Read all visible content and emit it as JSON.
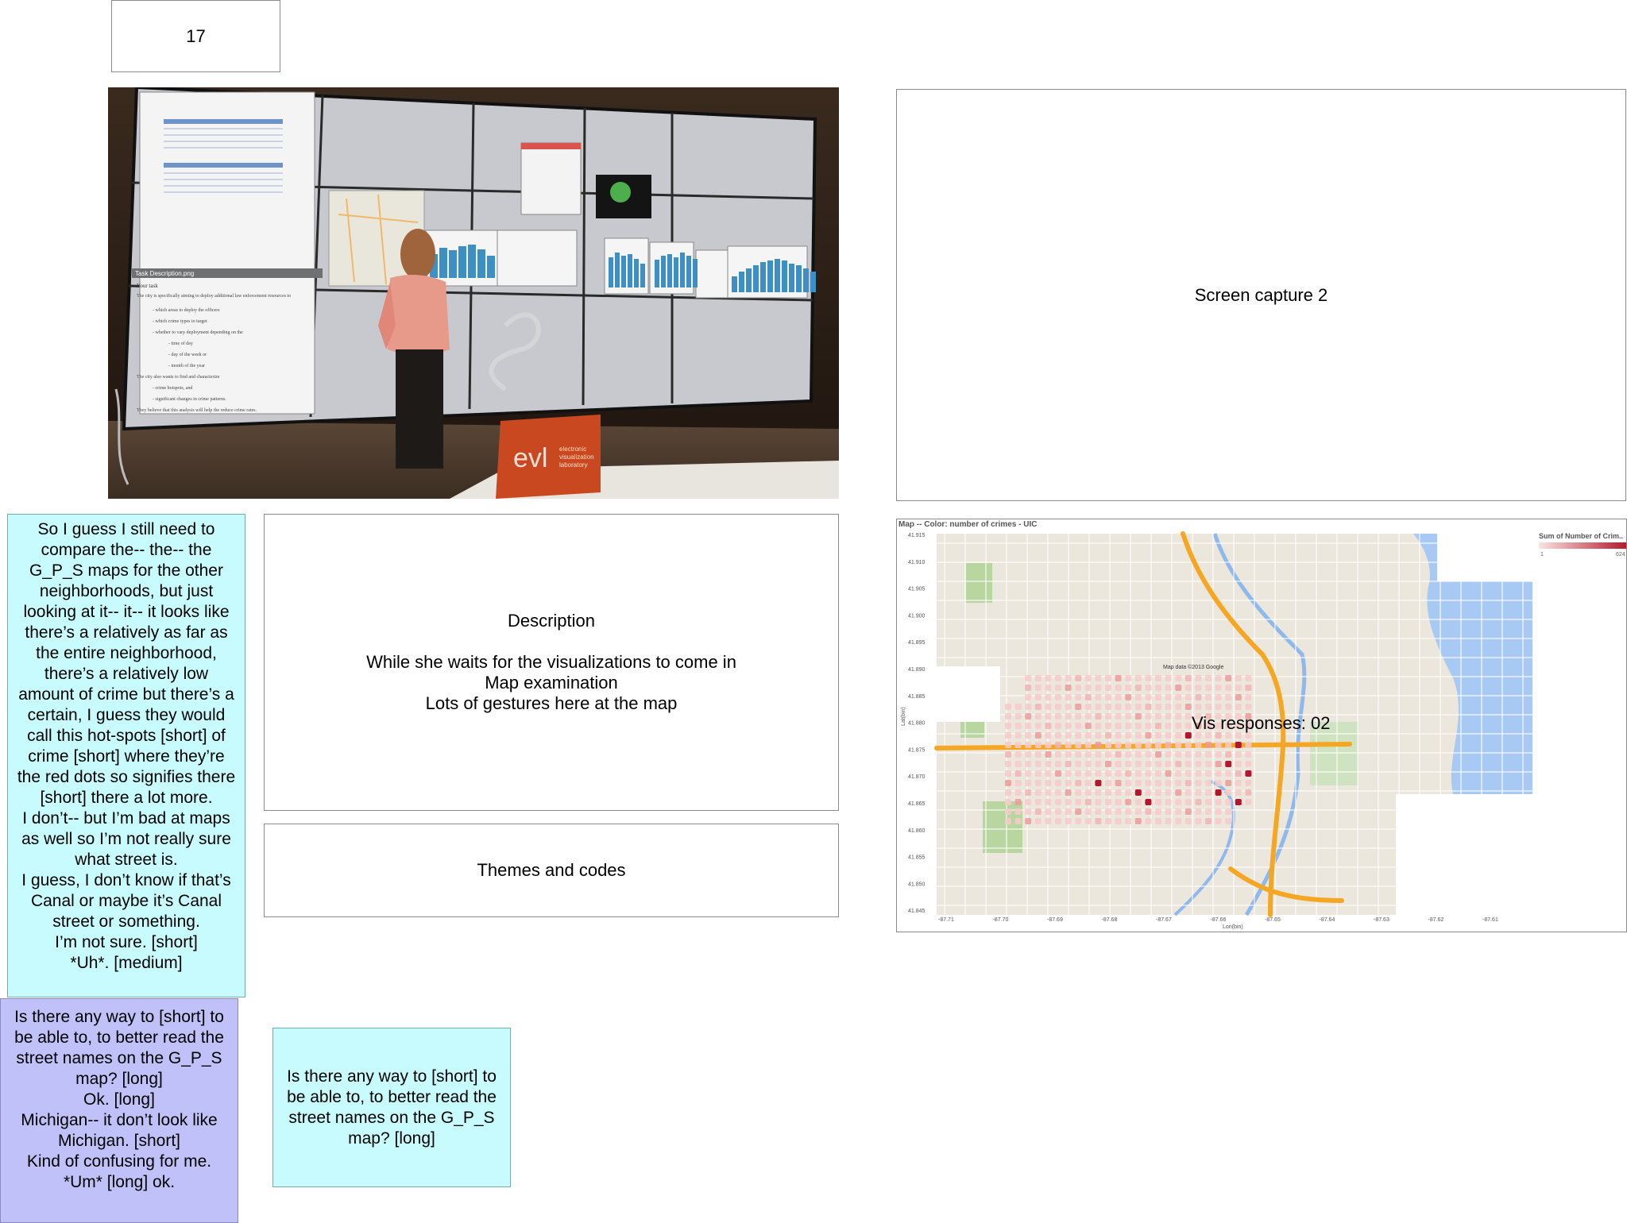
{
  "page": {
    "number": "17"
  },
  "screen_capture_2": {
    "label": "Screen capture 2"
  },
  "description": {
    "title": "Description",
    "lines": [
      "While she waits for the visualizations to come in",
      "Map examination",
      "Lots of gestures here at the map"
    ]
  },
  "themes": {
    "label": "Themes and codes"
  },
  "transcript_cyan": {
    "lines": [
      "So I guess I still need to",
      "compare the-- the-- the",
      "G_P_S maps for the other",
      "neighborhoods, but just",
      "looking at it-- it-- it looks like",
      "there’s a relatively as far as",
      "the entire neighborhood,",
      "there’s a relatively low",
      "amount of crime but there’s a",
      "certain, I guess they would",
      "call this hot-spots [short] of",
      "crime [short] where they’re",
      "the red dots so signifies there",
      "[short] there a lot more.",
      "I don’t-- but I’m bad at maps",
      "as well so I’m not really sure",
      "what street is.",
      "I guess, I don’t know if that’s",
      "Canal or maybe it’s Canal",
      "street or something.",
      "I’m not sure. [short]",
      "*Uh*. [medium]"
    ]
  },
  "transcript_purple": {
    "lines": [
      "Is there any way to [short] to",
      "be able to, to better read the",
      "street names on the G_P_S",
      "map? [long]",
      "Ok. [long]",
      "Michigan-- it don’t look like",
      "Michigan. [short]",
      "Kind of confusing for me.",
      "*Um* [long] ok."
    ]
  },
  "question_cyan": {
    "lines": [
      "Is there any way to [short] to",
      "be able to, to better read the",
      "street names on the G_P_S",
      "map? [long]"
    ]
  },
  "photo": {
    "display_title": "Task Description.png",
    "display_heading": "Your task",
    "display_lines": [
      "The city is specifically aiming to deploy additional law enforcement resources to",
      "- which areas to deploy the officers",
      "- which crime types to target",
      "- whether to vary deployment depending on the",
      "- time of day",
      "- day of the week or",
      "- month of the year",
      "The city also wants to find and characterize",
      "- crime hotspots, and",
      "- significant changes in crime patterns.",
      "They believe that this analysis will help the reduce crime rates."
    ],
    "sign_logo": "evl",
    "sign_lines": [
      "electronic",
      "visualization",
      "laboratory"
    ]
  },
  "map": {
    "header": "Map -- Color: number of crimes  - UIC",
    "legend_title": "Sum of Number of Crim..",
    "legend_min": "1",
    "legend_max": "624",
    "y_axis_label": "Lat(bin)",
    "x_axis_label": "Lon(bin)",
    "y_ticks": [
      "41.915",
      "41.910",
      "41.905",
      "41.900",
      "41.895",
      "41.890",
      "41.885",
      "41.880",
      "41.875",
      "41.870",
      "41.865",
      "41.860",
      "41.855",
      "41.850",
      "41.845"
    ],
    "x_ticks": [
      "-87.71",
      "-87.70",
      "-87.69",
      "-87.68",
      "-87.67",
      "-87.66",
      "-87.65",
      "-87.64",
      "-87.63",
      "-87.62",
      "-87.61"
    ],
    "overlay_text": "Vis responses: 02",
    "attribution": "Map data ©2013 Google"
  },
  "colors": {
    "cyan_note": "#c7fbfd",
    "purple_note": "#c0c1f8",
    "crime_hot": "#b2182b",
    "crime_cold": "#f4c6c6",
    "highway": "#f5a623",
    "water": "#a9c9f5"
  }
}
